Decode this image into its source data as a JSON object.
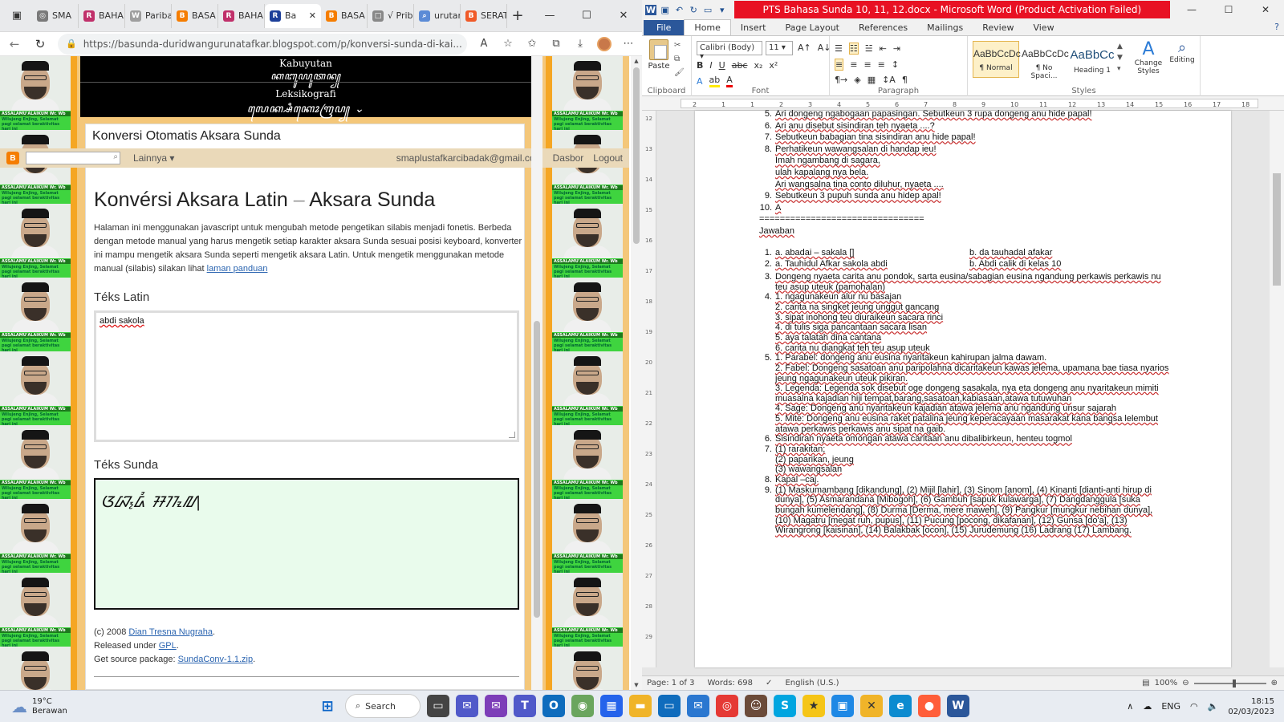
{
  "browser": {
    "tabs": [
      {
        "label": "SMA",
        "fav_color": "#7a7a7a",
        "fav_text": "◎"
      },
      {
        "label": "BAHA",
        "fav_color": "#c0306a",
        "fav_text": "R"
      },
      {
        "label": "Pariba",
        "fav_color": "#9e9e9e",
        "fav_text": "W"
      },
      {
        "label": "BASA",
        "fav_color": "#f57d00",
        "fav_text": "B"
      },
      {
        "label": "BAHA",
        "fav_color": "#c0306a",
        "fav_text": "R"
      },
      {
        "label": "Ba",
        "fav_color": "#1c3f99",
        "fav_text": "R",
        "active": true
      },
      {
        "label": "BASA",
        "fav_color": "#f57d00",
        "fav_text": "B"
      },
      {
        "label": "√ Prib",
        "fav_color": "#888888",
        "fav_text": "□"
      },
      {
        "label": "urutar",
        "fav_color": "#5b8bd6",
        "fav_text": "⌕"
      },
      {
        "label": "SERAT",
        "fav_color": "#f05a28",
        "fav_text": "B"
      }
    ],
    "url": "https://basunda-duridwangurunatafkar.blogspot.com/p/konversi-sunda-di-kai...",
    "window_controls": [
      "—",
      "☐",
      "✕"
    ]
  },
  "blog": {
    "header_line1": "Kabuyutan",
    "header_line2": "ꦏꦧꦸꦪꦸꦠꦤ꧀",
    "header_line3": "Leksikografi",
    "header_line4": "ꦭꦺꦏ꧀ꦱꦶꦏꦺꦴꦒꦿꦥ꧀ ⌄",
    "post_title": "Konversi Otomatis Aksara Sunda",
    "bar": {
      "more": "Lainnya ▾",
      "email": "smaplustafkarcibadak@gmail.com",
      "dashboard": "Dasbor",
      "logout": "Logout"
    },
    "heading_left": "Konvérsi Aksara Latin",
    "heading_dash": "–",
    "heading_right": "Aksara Sunda",
    "intro": "Halaman ini menggunakan javascript untuk mengubah metode pengetikan silabis menjadi fonetis. Berbeda dengan metode manual yang harus mengetik setiap karakter aksara Sunda sesuai posisi keyboard, konverter ini mampu mengetik aksara Sunda seperti mengetik aksara Latin. Untuk mengetik menggunakan metode manual (silabis) silakan lihat ",
    "intro_link": "laman panduan",
    "latin_label": "Téks Latin",
    "latin_value": "abdi sakola",
    "sunda_label": "Téks Sunda",
    "sunda_value": "ᮃᮘ᮪ᮓᮤ ᮞᮊᮧᮜ",
    "credit1_prefix": "(c) 2008 ",
    "credit1_link": "Dian Tresna Nugraha",
    "credit1_suffix": ".",
    "credit2_prefix": "Released under ",
    "credit2_link": "GPL",
    "credit2_suffix": ".",
    "credit3_prefix": "Get source package: ",
    "credit3_link": "SundaConv-1.1.zip",
    "credit3_suffix": ".",
    "side_banner_1": "ASSALAMU'ALAIKUM Wr. Wb",
    "side_banner_2": "Wilujeng Enjing, Selamat pagi selamat beraktivitas hari ini"
  },
  "word": {
    "title": "PTS Bahasa Sunda 10, 11, 12.docx  -  Microsoft Word (Product Activation Failed)",
    "tabs": [
      "File",
      "Home",
      "Insert",
      "Page Layout",
      "References",
      "Mailings",
      "Review",
      "View"
    ],
    "groups": {
      "clipboard": "Clipboard",
      "font": "Font",
      "paragraph": "Paragraph",
      "styles": "Styles",
      "paste": "Paste",
      "change_styles": "Change Styles",
      "editing": "Editing"
    },
    "font_name": "Calibri (Body)",
    "font_size": "11",
    "styles": [
      {
        "preview": "AaBbCcDc",
        "name": "¶ Normal"
      },
      {
        "preview": "AaBbCcDc",
        "name": "¶ No Spaci..."
      },
      {
        "preview": "AaBbCc",
        "name": "Heading 1"
      }
    ],
    "ruler_numbers": [
      "2",
      "1",
      "1",
      "2",
      "3",
      "4",
      "5",
      "6",
      "7",
      "8",
      "9",
      "10",
      "11",
      "12",
      "13",
      "14",
      "15",
      "16",
      "17",
      "18"
    ],
    "vruler_numbers": [
      "12",
      "13",
      "14",
      "15",
      "16",
      "17",
      "18",
      "19",
      "20",
      "21",
      "22",
      "23",
      "24",
      "25",
      "26",
      "27",
      "28",
      "29"
    ],
    "lines": [
      {
        "n": "5.",
        "t": "Ari dongeng ngabogaan papasingan. Sebutkeun 3 rupa dongeng anu hide papal!"
      },
      {
        "n": "6.",
        "t": "Ari anu disebut sisindiran teh nyaeta ....?"
      },
      {
        "n": "7.",
        "t": "Sebutkeun babagian tina sisindiran anu hide papal!"
      },
      {
        "n": "8.",
        "t": "Perhatikeun wawangsalan di handap ieu!"
      },
      {
        "n": "",
        "t": "Imah ngambang di sagara,"
      },
      {
        "n": "",
        "t": "ulah kapalang nya bela."
      },
      {
        "n": "",
        "t": "Ari wangsalna tina conto diluhur, nyaeta ...."
      },
      {
        "n": "9.",
        "t": "Sebutkeun 3 pupuh sunda anu hidep apal!"
      },
      {
        "n": "10.",
        "t": "A"
      }
    ],
    "separator": "================================",
    "answers_heading": "Jawaban",
    "answers": [
      {
        "n": "1.",
        "t": "a. abadai – sakala []",
        "t2": "b. da tauhadal afakar"
      },
      {
        "n": "2.",
        "t": "a. Tauhidul Afkar sakola abdi",
        "t2": "b. Abdi calik di kelas 10"
      },
      {
        "n": "3.",
        "t": "Dongeng nyaeta carita anu pondok, sarta eusina/sabagian eusina ngandung perkawis perkawis nu"
      },
      {
        "n": "",
        "t": "teu asup uteuk (pamohalan)"
      },
      {
        "n": "4.",
        "t": "1. ngagunakeun alur nu basajan"
      },
      {
        "n": "",
        "t": "2. carita na singket jeung unggut gancang"
      },
      {
        "n": "",
        "t": "3. sipat inohong teu diuraikeun sacara rinci"
      },
      {
        "n": "",
        "t": "4. di tulis siga pancantaan sacara lisan"
      },
      {
        "n": "",
        "t": "5. aya talatah dina cantana"
      },
      {
        "n": "",
        "t": "6. carita nu diangkat teh teu asup uteuk"
      },
      {
        "n": "5.",
        "t": "1. Parabel: dongeng anu eusina nyaritakeun kahirupan jalma dawam."
      },
      {
        "n": "",
        "t": "2. Fabel: Dongeng sasatoan anu paripolahna dicaritakeun kawas jelema, upamana bae tiasa nyarios"
      },
      {
        "n": "",
        "t": "   jeung ngagunakeun uteuk pikiran."
      },
      {
        "n": "",
        "t": "3. Legenda: Legenda sok disebut oge dongeng sasakala, nya eta dongeng anu nyaritakeun mimiti"
      },
      {
        "n": "",
        "t": "   muasalna kajadian hiji tempat,barang,sasatoan,kabiasaan,atawa tutuwuhan"
      },
      {
        "n": "",
        "t": "4. Sage: Dongeng anu nyaritakeun kajadian atawa jelema anu ngandung unsur sajarah"
      },
      {
        "n": "",
        "t": "5. Mite: Dongeng anu eusina raket patalina jeung keperacayaan masarakat kana bangsa lelembut"
      },
      {
        "n": "",
        "t": "   atawa perkawis perkawis anu sipat na gaib."
      },
      {
        "n": "6.",
        "t": "Sisindiran nyaeta omongan atawa caritaan anu dibalibirkeun, henteu togmol"
      },
      {
        "n": "7.",
        "t": "(1) rarakitan;"
      },
      {
        "n": "",
        "t": "(2) paparikan, jeung"
      },
      {
        "n": "",
        "t": "(3) wawangsalan"
      },
      {
        "n": "8.",
        "t": "Kapal –caj."
      },
      {
        "n": "9.",
        "t": "(1) Maskumambang [dikandung], (2) Mijil [lahir], (3) Sinom [anom], (4) Kinanti [dianti-anti hirup di"
      },
      {
        "n": "",
        "t": "dunya], (5) Asmarandana [Mibogoh], (6) Gambuh [sapuk kulawarga], (7) Dangdanggula [suka"
      },
      {
        "n": "",
        "t": "bungah kumelendang], (8) Durma [Derma, mere maweh], (9) Pangkur [mungkur nebihan dunya],"
      },
      {
        "n": "",
        "t": "(10) Magatru [megat ruh, pupus], (11) Pucung [pocong, dikafanan], (12) Gunsa [do'a], (13)"
      },
      {
        "n": "",
        "t": "Wirangrong [kaisinan], (14) Balakbak [ocon], (15) Jurudemung (16) Ladrang (17) Lambang."
      }
    ],
    "status": {
      "page": "Page: 1 of 3",
      "words": "Words: 698",
      "lang": "English (U.S.)",
      "zoom": "100%"
    }
  },
  "taskbar": {
    "temp": "19°C",
    "weather": "Berawan",
    "search_label": "Search",
    "lang": "ENG",
    "time": "18:15",
    "date": "02/03/2023"
  }
}
